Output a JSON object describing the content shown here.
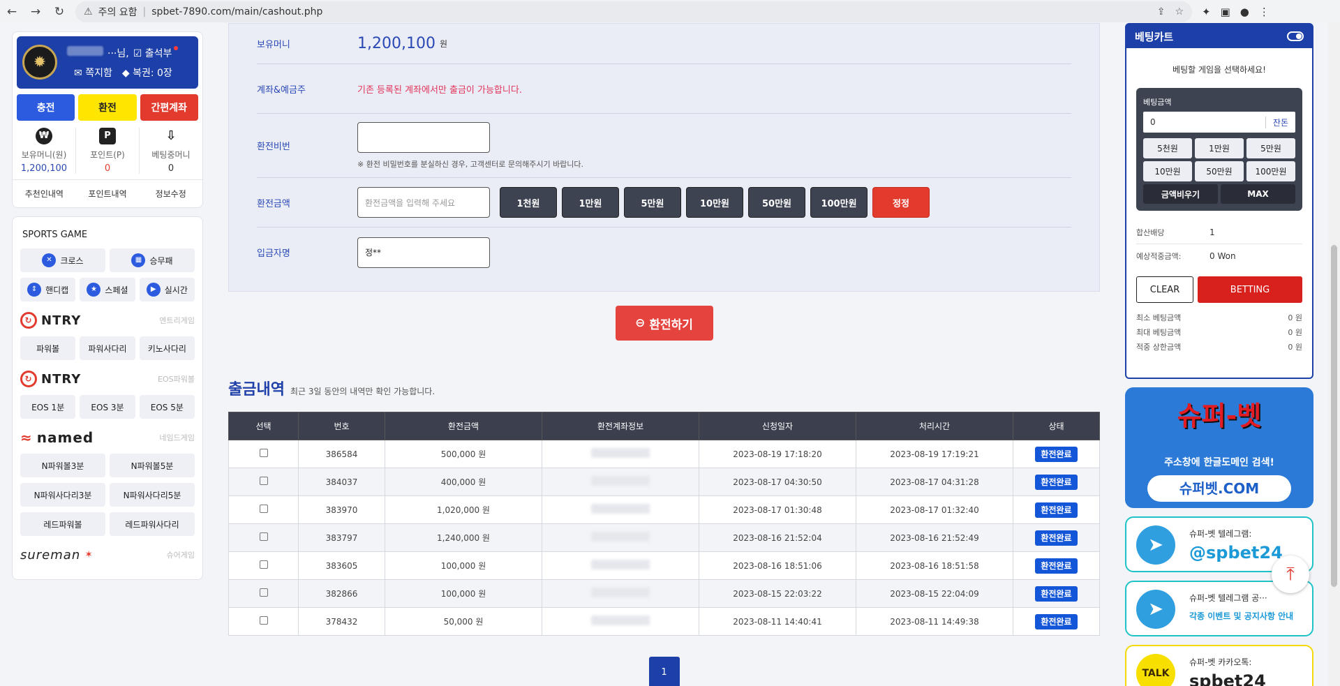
{
  "browser": {
    "warning": "주의 요함",
    "url": "spbet-7890.com/main/cashout.php"
  },
  "user": {
    "name_suffix": "···님,",
    "attendance": "출석부",
    "messages": "쪽지함",
    "coupons": "복권: 0장",
    "actions": [
      "충전",
      "환전",
      "간편계좌"
    ],
    "stats": [
      {
        "icon": "₩",
        "label": "보유머니(원)",
        "value": "1,200,100"
      },
      {
        "icon": "P",
        "label": "포인트(P)",
        "value": "0"
      },
      {
        "icon": "⇩",
        "label": "베팅중머니",
        "value": "0"
      }
    ],
    "links": [
      "추천인내역",
      "포인트내역",
      "정보수정"
    ]
  },
  "games": {
    "title": "SPORTS GAME",
    "sports": [
      "크로스",
      "승무패",
      "핸디캡",
      "스페셜",
      "실시간"
    ],
    "ntry1": {
      "brand": "NTRY",
      "sub": "엔트리게임",
      "items": [
        "파워볼",
        "파워사다리",
        "키노사다리"
      ]
    },
    "ntry2": {
      "brand": "NTRY",
      "sub": "EOS파워볼",
      "items": [
        "EOS 1분",
        "EOS 3분",
        "EOS 5분"
      ]
    },
    "named": {
      "brand": "named",
      "sub": "네임드게임",
      "items": [
        "N파워볼3분",
        "N파워볼5분",
        "N파워사다리3분",
        "N파워사다리5분",
        "레드파워볼",
        "레드파워사다리"
      ]
    },
    "sureman": {
      "brand": "sureman",
      "sub": "슈어게임"
    }
  },
  "form": {
    "money_label": "보유머니",
    "money_value": "1,200,100",
    "money_unit": "원",
    "account_label": "계좌&예금주",
    "account_notice": "기존 등록된 계좌에서만 출금이 가능합니다.",
    "pw_label": "환전비번",
    "pw_note": "※ 환전 비밀번호를 분실하신 경우, 고객센터로 문의해주시기 바랍니다.",
    "amount_label": "환전금액",
    "amount_placeholder": "환전금액을 입력해 주세요",
    "amount_buttons": [
      "1천원",
      "1만원",
      "5만원",
      "10만원",
      "50만원",
      "100만원"
    ],
    "reset": "정정",
    "depositor_label": "입금자명",
    "depositor_value": "정**",
    "submit": "환전하기"
  },
  "history": {
    "title": "출금내역",
    "subtitle": "최근 3일 동안의 내역만 확인 가능합니다.",
    "columns": [
      "선택",
      "번호",
      "환전금액",
      "환전계좌정보",
      "신청일자",
      "처리시간",
      "상태"
    ],
    "rows": [
      {
        "no": "386584",
        "amount": "500,000 원",
        "req": "2023-08-19 17:18:20",
        "done": "2023-08-19 17:19:21",
        "status": "환전완료"
      },
      {
        "no": "384037",
        "amount": "400,000 원",
        "req": "2023-08-17 04:30:50",
        "done": "2023-08-17 04:31:28",
        "status": "환전완료"
      },
      {
        "no": "383970",
        "amount": "1,020,000 원",
        "req": "2023-08-17 01:30:48",
        "done": "2023-08-17 01:32:40",
        "status": "환전완료"
      },
      {
        "no": "383797",
        "amount": "1,240,000 원",
        "req": "2023-08-16 21:52:04",
        "done": "2023-08-16 21:52:49",
        "status": "환전완료"
      },
      {
        "no": "383605",
        "amount": "100,000 원",
        "req": "2023-08-16 18:51:06",
        "done": "2023-08-16 18:51:58",
        "status": "환전완료"
      },
      {
        "no": "382866",
        "amount": "100,000 원",
        "req": "2023-08-15 22:03:22",
        "done": "2023-08-15 22:04:09",
        "status": "환전완료"
      },
      {
        "no": "378432",
        "amount": "50,000 원",
        "req": "2023-08-11 14:40:41",
        "done": "2023-08-11 14:49:38",
        "status": "환전완료"
      }
    ],
    "page": "1"
  },
  "cart": {
    "title": "베팅카트",
    "hint": "베팅할 게임을 선택하세요!",
    "bet_label": "베팅금액",
    "bet_value": "0",
    "balance_btn": "잔돈",
    "quick": [
      "5천원",
      "1만원",
      "5만원",
      "10만원",
      "50만원",
      "100만원"
    ],
    "clear_amount": "금액비우기",
    "max": "MAX",
    "odds_label": "합산배당",
    "odds_value": "1",
    "expected_label": "예상적중금액:",
    "expected_value": "0 Won",
    "clear": "CLEAR",
    "betting": "BETTING",
    "limits": [
      {
        "k": "최소 베팅금액",
        "v": "0 원"
      },
      {
        "k": "최대 베팅금액",
        "v": "0 원"
      },
      {
        "k": "적중 상한금액",
        "v": "0 원"
      }
    ]
  },
  "banners": {
    "super_logo": "슈퍼-벳",
    "super_slogan": "주소창에 한글도메인 검색!",
    "super_domain": "슈퍼벳.COM",
    "tg1_a": "슈퍼-벳 텔레그램:",
    "tg1_b": "@spbet24",
    "tg2_a": "슈퍼-벳 텔레그램 공···",
    "tg2_b": "각종 이벤트 및 공지사항 안내",
    "kakao_a": "슈퍼-벳 카카오톡:",
    "kakao_b": "spbet24"
  },
  "colors": {
    "brand_blue": "#1c3fa8",
    "charge_blue": "#2c5be0",
    "exchange_yellow": "#ffe600",
    "red": "#e23b2e"
  }
}
